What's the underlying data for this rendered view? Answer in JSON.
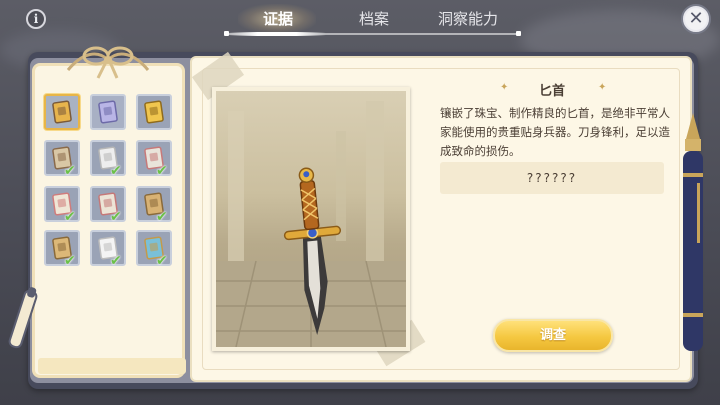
{
  "header": {
    "info_label": "i",
    "tabs": [
      {
        "label": "证据",
        "active": true
      },
      {
        "label": "档案",
        "active": false
      },
      {
        "label": "洞察能力",
        "active": false
      }
    ],
    "close_label": "✕"
  },
  "evidence_grid": {
    "items": [
      {
        "icon": "dagger-icon",
        "selected": true,
        "checked": false
      },
      {
        "icon": "portrait-badge-icon",
        "selected": false,
        "checked": false
      },
      {
        "icon": "lyre-icon",
        "selected": false,
        "checked": false
      },
      {
        "icon": "framed-portrait-icon",
        "selected": false,
        "checked": true
      },
      {
        "icon": "letter-paper-icon",
        "selected": false,
        "checked": true
      },
      {
        "icon": "photo-collection-icon",
        "selected": false,
        "checked": true
      },
      {
        "icon": "photo-board-icon",
        "selected": false,
        "checked": true
      },
      {
        "icon": "photo-strip-icon",
        "selected": false,
        "checked": true
      },
      {
        "icon": "clipboard-icon",
        "selected": false,
        "checked": true
      },
      {
        "icon": "clipboard-note-icon",
        "selected": false,
        "checked": true
      },
      {
        "icon": "blank-paper-icon",
        "selected": false,
        "checked": true
      },
      {
        "icon": "flower-brooch-icon",
        "selected": false,
        "checked": true
      }
    ],
    "check_symbol": "✔"
  },
  "detail": {
    "title": "匕首",
    "title_ornament_left": "✦",
    "title_ornament_right": "✦",
    "description": "镶嵌了珠宝、制作精良的匕首，是绝非平常人家能使用的贵重贴身兵器。刀身锋利，足以造成致命的损伤。",
    "hint": "??????",
    "investigate_label": "调查"
  },
  "colors": {
    "accent_gold": "#f5c841",
    "check_green": "#6cc04a",
    "panel_cream": "#fdf7e6",
    "frame_navy": "#474a5c"
  }
}
